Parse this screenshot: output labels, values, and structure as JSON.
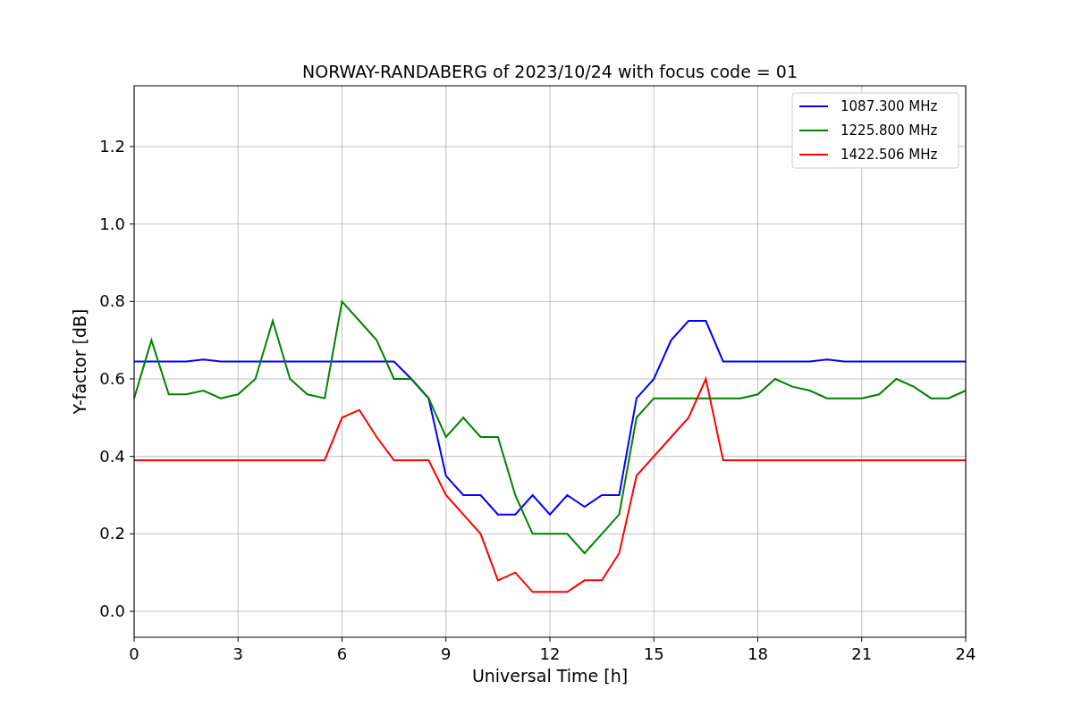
{
  "chart_data": {
    "type": "line",
    "title": "NORWAY-RANDABERG of 2023/10/24 with focus code = 01",
    "xlabel": "Universal Time [h]",
    "ylabel": "Y-factor [dB]",
    "x": [
      0,
      0.5,
      1,
      1.5,
      2,
      2.5,
      3,
      3.5,
      4,
      4.5,
      5,
      5.5,
      6,
      6.5,
      7,
      7.5,
      8,
      8.5,
      9,
      9.5,
      10,
      10.5,
      11,
      11.5,
      12,
      12.5,
      13,
      13.5,
      14,
      14.5,
      15,
      15.5,
      16,
      16.5,
      17,
      17.5,
      18,
      18.5,
      19,
      19.5,
      20,
      20.5,
      21,
      21.5,
      22,
      22.5,
      23,
      23.5,
      24
    ],
    "series": [
      {
        "name": "1087.300 MHz",
        "color": "#0000ff",
        "values": [
          0.645,
          0.645,
          0.645,
          0.645,
          0.65,
          0.645,
          0.645,
          0.645,
          0.645,
          0.645,
          0.645,
          0.645,
          0.645,
          0.645,
          0.645,
          0.645,
          0.6,
          0.55,
          0.35,
          0.3,
          0.3,
          0.25,
          0.25,
          0.3,
          0.25,
          0.3,
          0.27,
          0.3,
          0.3,
          0.55,
          0.6,
          0.7,
          0.75,
          0.75,
          0.645,
          0.645,
          0.645,
          0.645,
          0.645,
          0.645,
          0.65,
          0.645,
          0.645,
          0.645,
          0.645,
          0.645,
          0.645,
          0.645,
          0.645
        ]
      },
      {
        "name": "1225.800 MHz",
        "color": "#008000",
        "values": [
          0.55,
          0.7,
          0.56,
          0.56,
          0.57,
          0.55,
          0.56,
          0.6,
          0.75,
          0.6,
          0.56,
          0.55,
          0.8,
          0.75,
          0.7,
          0.6,
          0.6,
          0.55,
          0.45,
          0.5,
          0.45,
          0.45,
          0.3,
          0.2,
          0.2,
          0.2,
          0.15,
          0.2,
          0.25,
          0.5,
          0.55,
          0.55,
          0.55,
          0.55,
          0.55,
          0.55,
          0.56,
          0.6,
          0.58,
          0.57,
          0.55,
          0.55,
          0.55,
          0.56,
          0.6,
          0.58,
          0.55,
          0.55,
          0.57
        ]
      },
      {
        "name": "1422.506 MHz",
        "color": "#ff0000",
        "values": [
          0.39,
          0.39,
          0.39,
          0.39,
          0.39,
          0.39,
          0.39,
          0.39,
          0.39,
          0.39,
          0.39,
          0.39,
          0.5,
          0.52,
          0.45,
          0.39,
          0.39,
          0.39,
          0.3,
          0.25,
          0.2,
          0.08,
          0.1,
          0.05,
          0.05,
          0.05,
          0.08,
          0.08,
          0.15,
          0.35,
          0.4,
          0.45,
          0.5,
          0.6,
          0.39,
          0.39,
          0.39,
          0.39,
          0.39,
          0.39,
          0.39,
          0.39,
          0.39,
          0.39,
          0.39,
          0.39,
          0.39,
          0.39,
          0.39
        ]
      }
    ],
    "grid": true,
    "legend": true,
    "xlim": [
      0,
      24
    ],
    "ylim": [
      -0.067,
      1.357
    ],
    "xticks": [
      0,
      3,
      6,
      9,
      12,
      15,
      18,
      21,
      24
    ],
    "yticks": [
      {
        "value": 0,
        "label": "0.0"
      },
      {
        "value": 0.2,
        "label": "0.2"
      },
      {
        "value": 0.4,
        "label": "0.4"
      },
      {
        "value": 0.6,
        "label": "0.6"
      },
      {
        "value": 0.8,
        "label": "0.8"
      },
      {
        "value": 1,
        "label": "1.0"
      },
      {
        "value": 1.2,
        "label": "1.2"
      }
    ]
  }
}
